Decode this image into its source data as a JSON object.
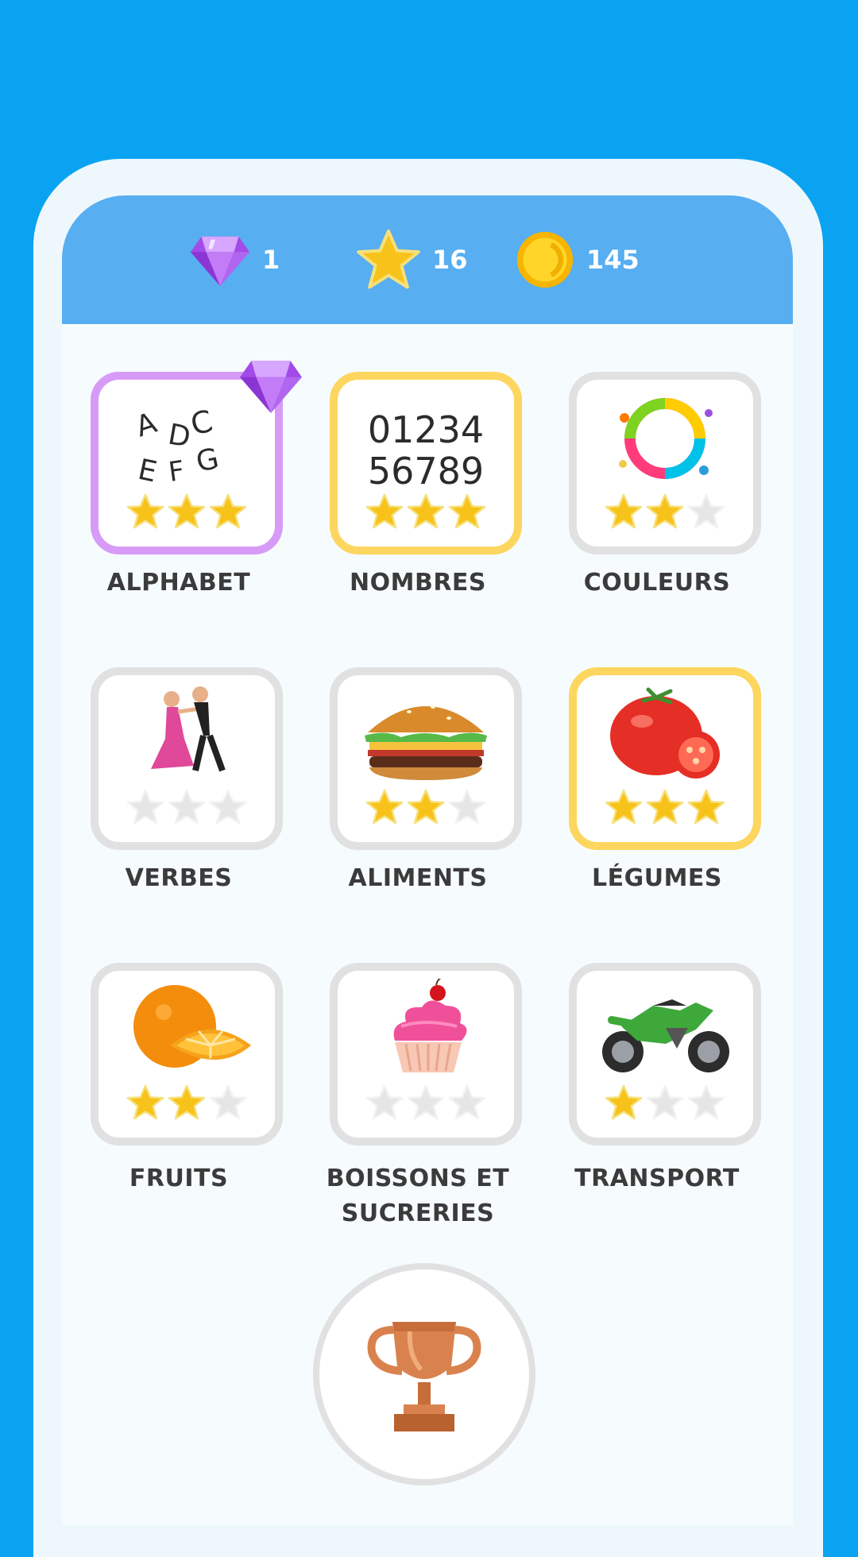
{
  "header": {
    "gems": "1",
    "stars": "16",
    "coins": "145"
  },
  "categories": [
    {
      "label": "ALPHABET",
      "stars_earned": 3,
      "highlight": "purple",
      "badge": "diamond-icon"
    },
    {
      "label": "NOMBRES",
      "stars_earned": 3,
      "highlight": "gold",
      "art_lines": [
        "01234",
        "56789"
      ]
    },
    {
      "label": "COULEURS",
      "stars_earned": 2,
      "highlight": "none"
    },
    {
      "label": "VERBES",
      "stars_earned": 0,
      "highlight": "none"
    },
    {
      "label": "ALIMENTS",
      "stars_earned": 2,
      "highlight": "none"
    },
    {
      "label": "LÉGUMES",
      "stars_earned": 3,
      "highlight": "gold"
    },
    {
      "label": "FRUITS",
      "stars_earned": 2,
      "highlight": "none"
    },
    {
      "label": "BOISSONS ET",
      "label2": "SUCRERIES",
      "stars_earned": 0,
      "highlight": "none"
    },
    {
      "label": "TRANSPORT",
      "stars_earned": 1,
      "highlight": "none"
    }
  ],
  "alphabet_letters": [
    "A",
    "D",
    "C",
    "E",
    "F",
    "G"
  ],
  "colors": {
    "background": "#0aa3f2",
    "header": "#57aef1",
    "star_gold": "#f7c21a",
    "star_empty": "#e6e6e6",
    "tile_gold": "#fdd65f",
    "tile_purple": "#d79bf7"
  },
  "icons": {
    "gems": "diamond-icon",
    "stars": "star-icon",
    "coins": "coin-icon",
    "trophy": "trophy-icon"
  }
}
